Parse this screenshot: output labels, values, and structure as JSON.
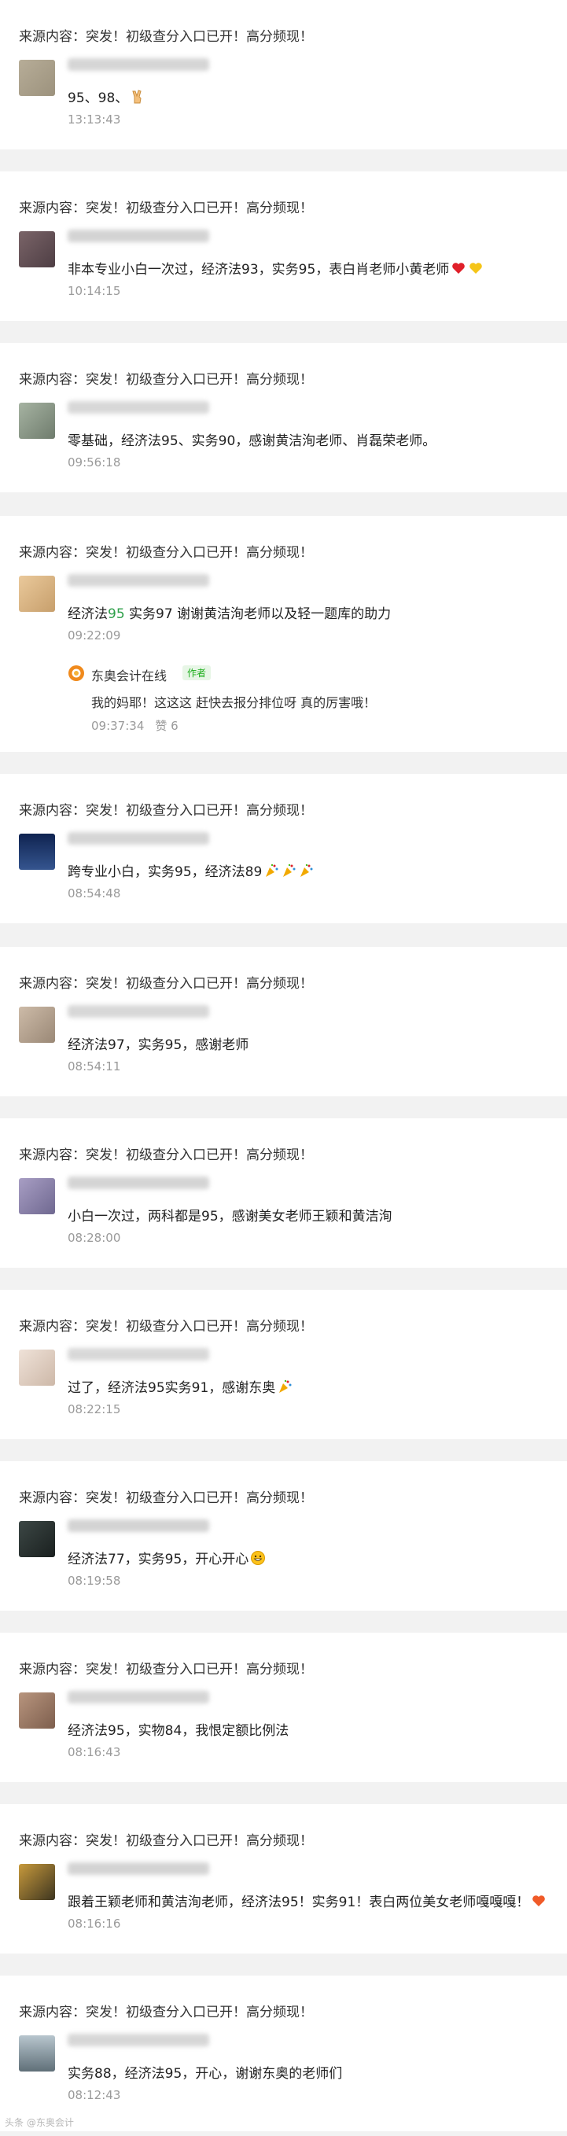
{
  "source_label": "来源内容：突发！初级查分入口已开！高分频现！",
  "comments": [
    {
      "text": "95、98、",
      "time": "13:13:43",
      "emoji": "victory-hand",
      "avatar_color": "#a99e86"
    },
    {
      "text": "非本专业小白一次过，经济法93，实务95，表白肖老师小黄老师",
      "time": "10:14:15",
      "emoji": "red-heart-yellow-heart",
      "avatar_color": "#6b5a60"
    },
    {
      "text": "零基础，经济法95、实务90，感谢黄洁洵老师、肖磊荣老师。",
      "time": "09:56:18",
      "emoji": "",
      "avatar_color": "#8d9a8c"
    },
    {
      "text_pre": "经济法",
      "text_hl": "95",
      "text_post": " 实务97 谢谢黄洁洵老师以及轻一题库的助力",
      "time": "09:22:09",
      "emoji": "",
      "avatar_color": "#d9b88a"
    },
    {
      "text": "跨专业小白，实务95，经济法89",
      "time": "08:54:48",
      "emoji": "party-popper",
      "avatar_color": "#1f3c73"
    },
    {
      "text": "经济法97，实务95，感谢老师",
      "time": "08:54:11",
      "emoji": "",
      "avatar_color": "#b9a897"
    },
    {
      "text": "小白一次过，两科都是95，感谢美女老师王颖和黄洁洵",
      "time": "08:28:00",
      "emoji": "",
      "avatar_color": "#8f86a8"
    },
    {
      "text": "过了，经济法95实务91，感谢东奥",
      "time": "08:22:15",
      "emoji": "party-popper",
      "avatar_color": "#e0d0c4"
    },
    {
      "text": "经济法77，实务95，开心开心",
      "time": "08:19:58",
      "emoji": "grinning-face",
      "avatar_color": "#2b3432"
    },
    {
      "text": "经济法95，实物84，我恨定额比例法",
      "time": "08:16:43",
      "emoji": "",
      "avatar_color": "#9a7d6a"
    },
    {
      "text": "跟着王颖老师和黄洁洵老师，经济法95！实务91！表白两位美女老师嘎嘎嘎！",
      "time": "08:16:16",
      "emoji": "red-heart",
      "avatar_color": "#3d3520"
    },
    {
      "text": "实务88，经济法95，开心，谢谢东奥的老师们",
      "time": "08:12:43",
      "emoji": "",
      "avatar_color": "#7b8a92"
    }
  ],
  "reply": {
    "name": "东奥会计在线",
    "badge": "作者",
    "text": "我的妈耶！这这这    赶快去报分排位呀    真的厉害哦！",
    "time": "09:37:34",
    "likes": "赞 6"
  },
  "watermark": "头条 @东奥会计"
}
